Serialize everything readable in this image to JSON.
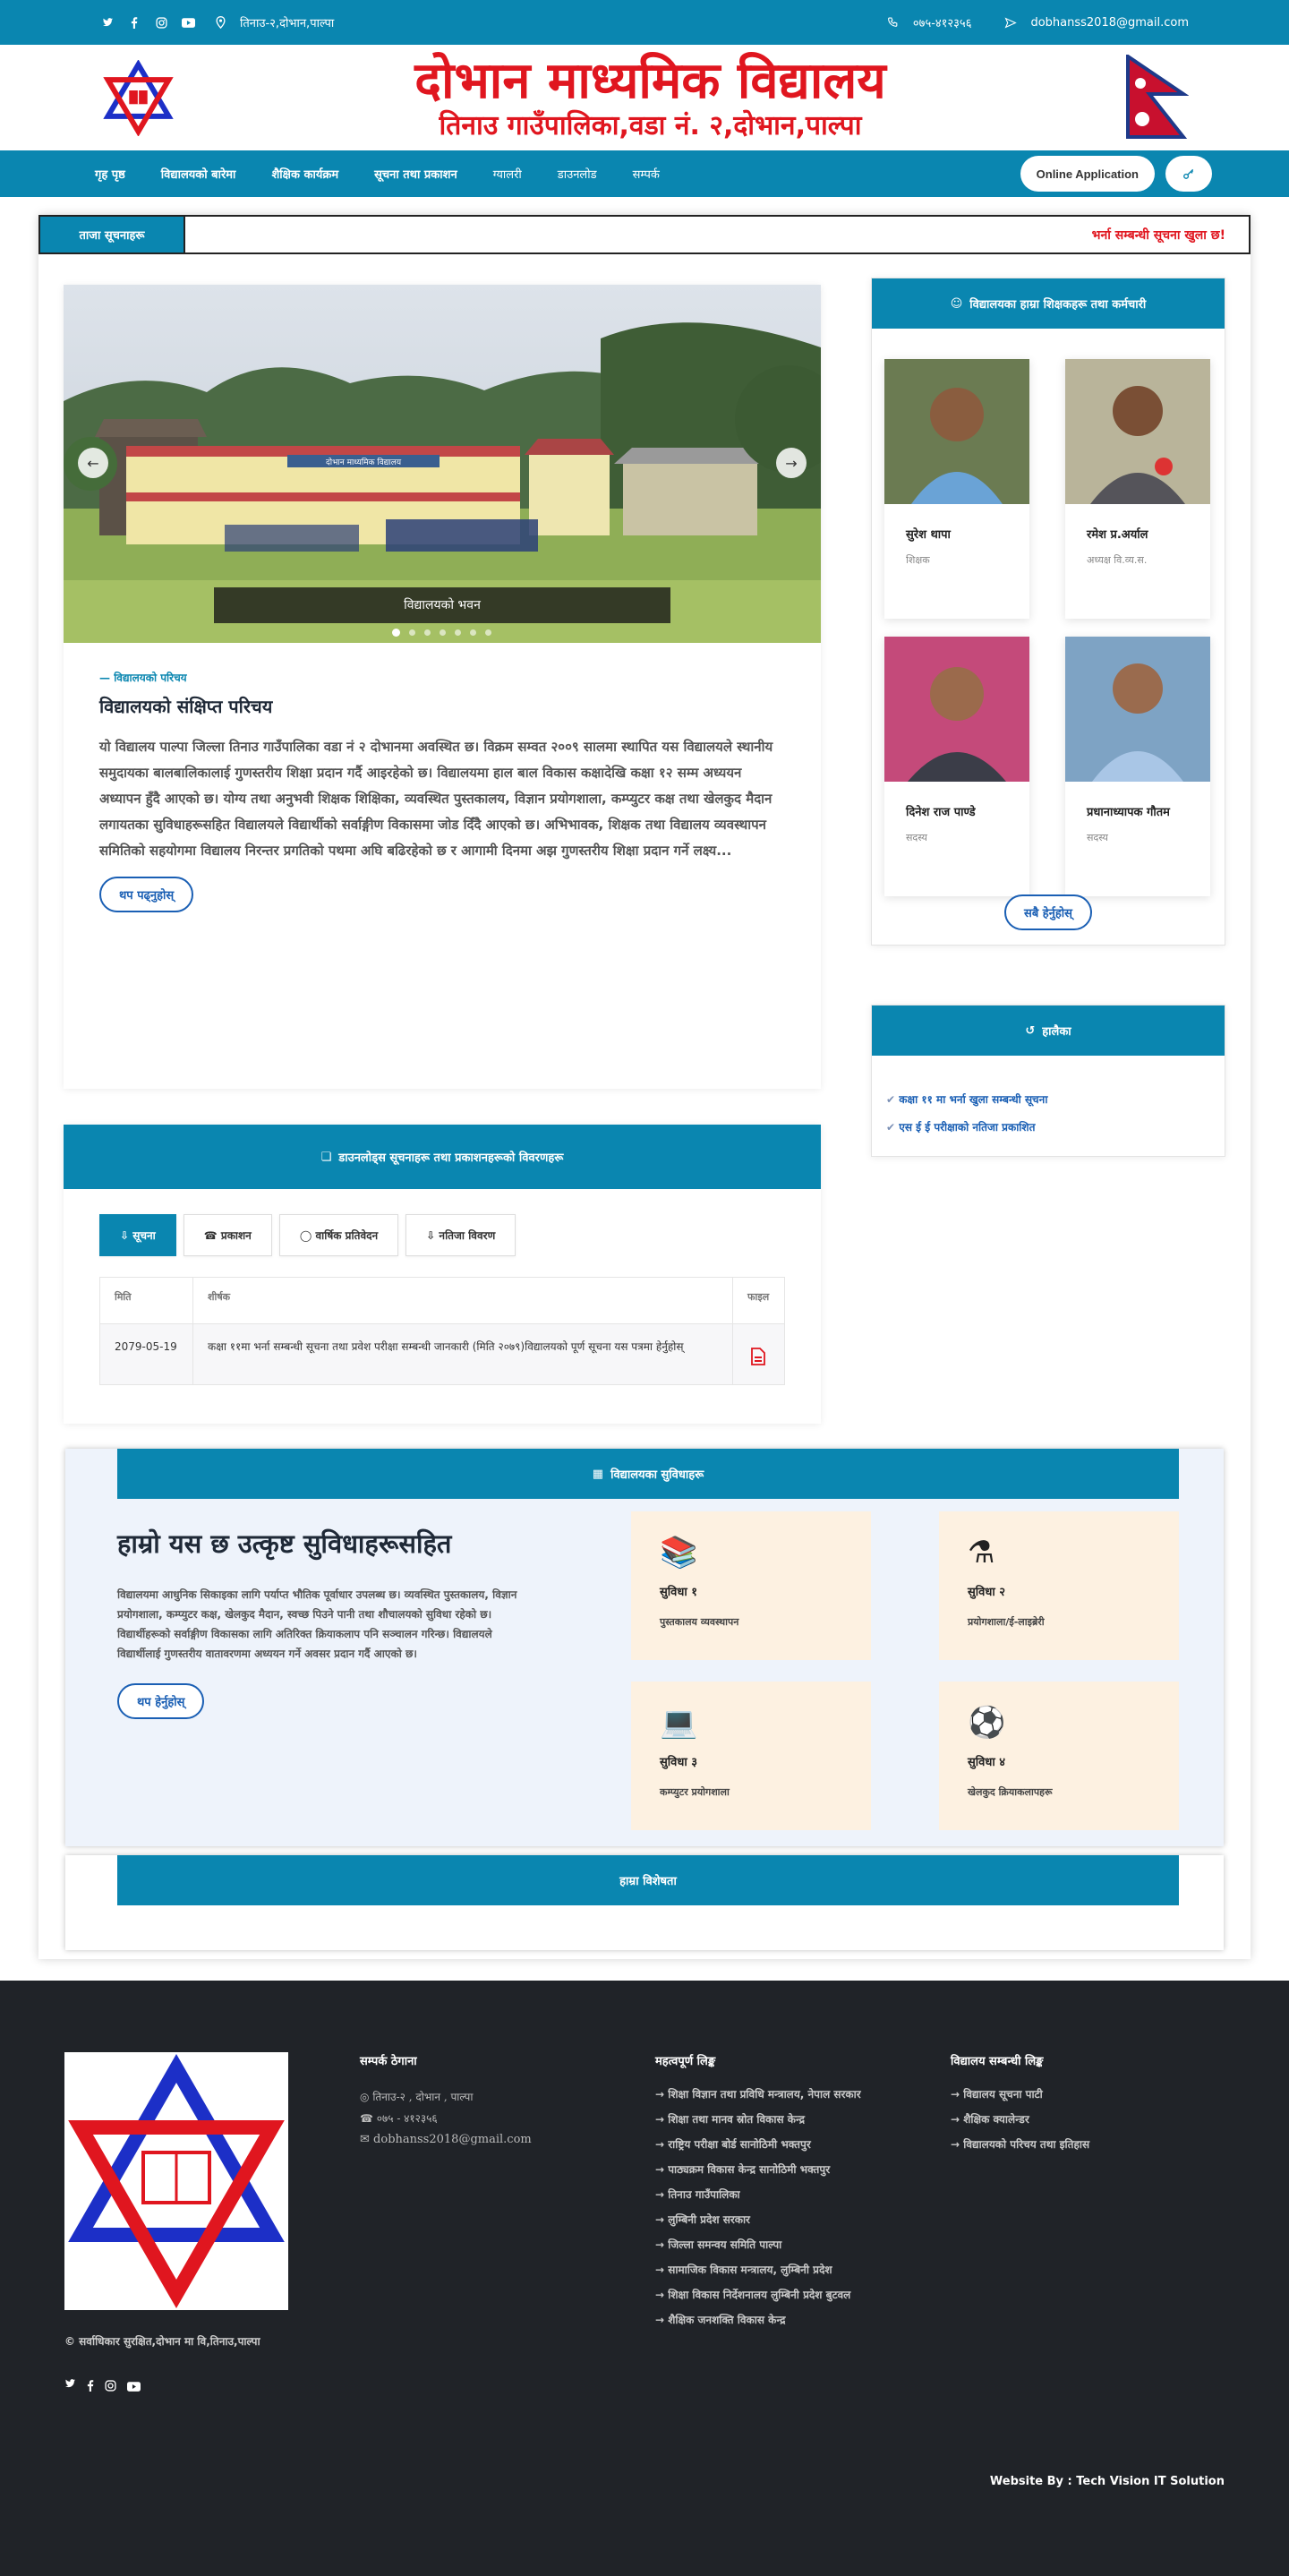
{
  "topbar": {
    "location": "तिनाउ-२,दोभान,पाल्पा",
    "phone": "०७५-४१२३५६",
    "email": "dobhanss2018@gmail.com"
  },
  "header": {
    "school_name": "दोभान माध्यमिक विद्यालय",
    "school_address": "तिनाउ गाउँपालिका,वडा नं. २,दोभान,पाल्पा"
  },
  "nav": {
    "items": [
      "गृह पृष्ठ",
      "विद्यालयको बारेमा",
      "शैक्षिक कार्यक्रम",
      "सूचना तथा प्रकाशन",
      "ग्यालरी",
      "डाउनलोड",
      "सम्पर्क"
    ],
    "online_application": "Online Application"
  },
  "notice_bar": {
    "label": "ताजा सूचनाहरू",
    "text": "भर्ना सम्बन्धी सूचना खुला छ!"
  },
  "slider": {
    "caption": "विद्यालयको भवन",
    "total_dots": 7,
    "active_dot": 0,
    "sign_text": "दोभान माध्यमिक विद्यालय"
  },
  "intro": {
    "kicker": "विद्यालयको परिचय",
    "title": "विद्यालयको संक्षिप्त परिचय",
    "body": "यो विद्यालय पाल्पा जिल्ला तिनाउ गाउँपालिका वडा नं २ दोभानमा अवस्थित छ। विक्रम सम्वत २००९ सालमा स्थापित यस विद्यालयले स्थानीय समुदायका बालबालिकालाई गुणस्तरीय शिक्षा प्रदान गर्दै आइरहेको छ। विद्यालयमा हाल बाल विकास कक्षादेखि कक्षा १२ सम्म अध्ययन अध्यापन हुँदै आएको छ। योग्य तथा अनुभवी शिक्षक शिक्षिका, व्यवस्थित पुस्तकालय, विज्ञान प्रयोगशाला, कम्प्युटर कक्ष तथा खेलकुद मैदान लगायतका सुविधाहरूसहित विद्यालयले विद्यार्थीको सर्वाङ्गीण विकासमा जोड दिँदै आएको छ। अभिभावक, शिक्षक तथा विद्यालय व्यवस्थापन समितिको सहयोगमा विद्यालय निरन्तर प्रगतिको पथमा अघि बढिरहेको छ र आगामी दिनमा अझ गुणस्तरीय शिक्षा प्रदान गर्ने लक्ष्य...",
    "read_more": "थप पढ्नुहोस्"
  },
  "downloads": {
    "title": "डाउनलोड्स सूचनाहरू तथा प्रकाशनहरूको विवरणहरू",
    "tabs": [
      "सूचना",
      "प्रकाशन",
      "वार्षिक प्रतिवेदन",
      "नतिजा विवरण"
    ],
    "columns": [
      "मिति",
      "शीर्षक",
      "फाइल"
    ],
    "rows": [
      {
        "date": "2079-05-19",
        "title": "कक्षा ११मा भर्ना सम्बन्धी सूचना तथा प्रवेश परीक्षा सम्बन्धी जानकारी (मिति २०७९)विद्यालयको पूर्ण सूचना यस पत्रमा हेर्नुहोस्",
        "file_icon": "pdf-file-icon"
      }
    ]
  },
  "staff_panel": {
    "title": "विद्यालयका हाम्रा शिक्षकहरू तथा कर्मचारी",
    "members": [
      {
        "name": "सुरेश थापा",
        "role": "शिक्षक"
      },
      {
        "name": "रमेश प्र.अर्याल",
        "role": "अध्यक्ष वि.व्य.स."
      },
      {
        "name": "दिनेश राज पाण्डे",
        "role": "सदस्य"
      },
      {
        "name": "प्रधानाध्यापक गौतम",
        "role": "सदस्य"
      }
    ],
    "view_all": "सबै हेर्नुहोस्"
  },
  "recent_panel": {
    "title": "हालैका",
    "items": [
      "कक्षा ११ मा भर्ना खुला सम्बन्धी सूचना",
      "एस ई ई परीक्षाको नतिजा प्रकाशित"
    ]
  },
  "facilities": {
    "section_title": "विद्यालयका सुविधाहरू",
    "heading": "हाम्रो यस छ उत्कृष्ट सुविधाहरूसहित",
    "body": "विद्यालयमा आधुनिक सिकाइका लागि पर्याप्त भौतिक पूर्वाधार उपलब्ध छ। व्यवस्थित पुस्तकालय, विज्ञान प्रयोगशाला, कम्प्युटर कक्ष, खेलकुद मैदान, स्वच्छ पिउने पानी तथा शौचालयको सुविधा रहेको छ। विद्यार्थीहरूको सर्वाङ्गीण विकासका लागि अतिरिक्त क्रियाकलाप पनि सञ्चालन गरिन्छ। विद्यालयले विद्यार्थीलाई गुणस्तरीय वातावरणमा अध्ययन गर्ने अवसर प्रदान गर्दै आएको छ।",
    "button": "थप हेर्नुहोस्",
    "cards": [
      {
        "icon": "library-icon",
        "title": "सुविधा १",
        "subtitle": "पुस्तकालय व्यवस्थापन"
      },
      {
        "icon": "lab-icon",
        "title": "सुविधा २",
        "subtitle": "प्रयोगशाला/ई-लाइब्रेरी"
      },
      {
        "icon": "computer-icon",
        "title": "सुविधा ३",
        "subtitle": "कम्प्युटर प्रयोगशाला"
      },
      {
        "icon": "sports-icon",
        "title": "सुविधा ४",
        "subtitle": "खेलकुद क्रियाकलापहरू"
      }
    ]
  },
  "bottom_box": {
    "title": "हाम्रा विशेषता"
  },
  "footer": {
    "copyright": "© सर्वाधिकार सुरक्षित,दोभान मा वि,तिनाउ,पाल्पा",
    "contact_title": "सम्पर्क ठेगाना",
    "contact_address": "तिनाउ-२ , दोभान , पाल्पा",
    "contact_phone": "०७५ - ४१२३५६",
    "contact_email": "dobhanss2018@gmail.com",
    "links_title": "महत्वपूर्ण लिङ्क",
    "links": [
      "शिक्षा विज्ञान तथा प्रविधि मन्त्रालय, नेपाल सरकार",
      "शिक्षा तथा मानव स्रोत विकास केन्द्र",
      "राष्ट्रिय परीक्षा बोर्ड सानोठिमी भक्तपुर",
      "पाठ्यक्रम विकास केन्द्र सानोठिमी भक्तपुर",
      "तिनाउ गाउँपालिका",
      "लुम्बिनी प्रदेश सरकार",
      "जिल्ला समन्वय समिति पाल्पा",
      "सामाजिक विकास मन्त्रालय, लुम्बिनी प्रदेश",
      "शिक्षा विकास निर्देशनालय लुम्बिनी प्रदेश बुटवल",
      "शैक्षिक जनशक्ति विकास केन्द्र"
    ],
    "quick_title": "विद्यालय सम्बन्धी लिङ्क",
    "quick_links": [
      "विद्यालय सूचना पाटी",
      "शैक्षिक क्यालेन्डर",
      "विद्यालयको परिचय तथा इतिहास"
    ],
    "credit": "Website By : Tech Vision IT Solution"
  },
  "colors": {
    "primary": "#0a86b0",
    "accent_red": "#e0161f",
    "footer_bg": "#202328",
    "facility_card": "#fdf1e1"
  }
}
